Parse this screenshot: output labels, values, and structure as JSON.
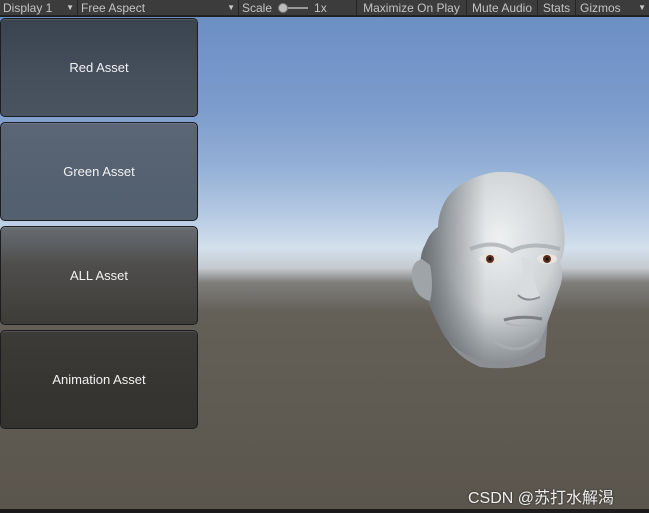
{
  "toolbar": {
    "display_label": "Display 1",
    "aspect_label": "Free Aspect",
    "scale_label": "Scale",
    "scale_value": "1x",
    "scale_slider_fraction": 0.1,
    "maximize_label": "Maximize On Play",
    "mute_label": "Mute Audio",
    "stats_label": "Stats",
    "gizmos_label": "Gizmos"
  },
  "buttons": {
    "red": "Red Asset",
    "green": "Green Asset",
    "all": "ALL Asset",
    "animation": "Animation Asset"
  },
  "watermark": "CSDN @苏打水解渴",
  "colors": {
    "toolbar_bg": "#3c3c3c",
    "sky_top": "#6c8fc4",
    "horizon": "#d3e0ec",
    "ground": "#5a554d"
  }
}
